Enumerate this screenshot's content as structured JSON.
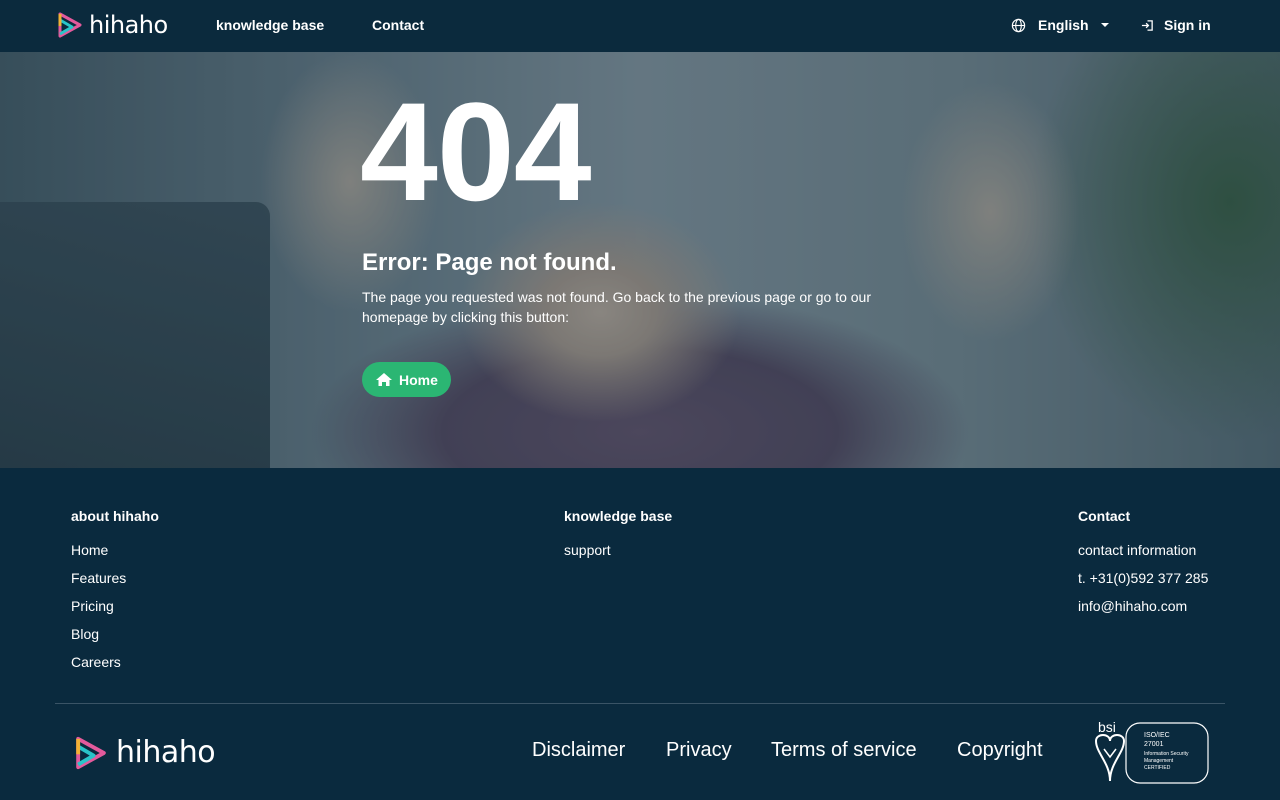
{
  "nav": {
    "logo_text": "hihaho",
    "links": [
      "knowledge base",
      "Contact"
    ],
    "language": "English",
    "sign_in": "Sign in"
  },
  "hero": {
    "code": "404",
    "title": "Error: Page not found.",
    "message": "The page you requested was not found. Go back to the previous page or go to our homepage by clicking this button:",
    "home_button": "Home",
    "button_color": "#2bb673"
  },
  "footer": {
    "columns": [
      {
        "title": "about hihaho",
        "links": [
          "Home",
          "Features",
          "Pricing",
          "Blog",
          "Careers"
        ]
      },
      {
        "title": "knowledge base",
        "links": [
          "support"
        ]
      },
      {
        "title": "Contact",
        "links": [
          "contact information",
          "t. +31(0)592 377 285",
          "info@hihaho.com"
        ]
      }
    ],
    "logo_text": "hihaho",
    "bottom_links": [
      "Disclaimer",
      "Privacy",
      "Terms of service",
      "Copyright"
    ],
    "cert": {
      "brand": "bsi",
      "line1": "ISO/IEC",
      "line2": "27001",
      "line3": "Information Security",
      "line4": "Management",
      "line5": "CERTIFIED"
    }
  },
  "colors": {
    "nav_bg": "#0b2a3d",
    "footer_bg": "#0a2a3e",
    "accent": "#2bb673"
  }
}
